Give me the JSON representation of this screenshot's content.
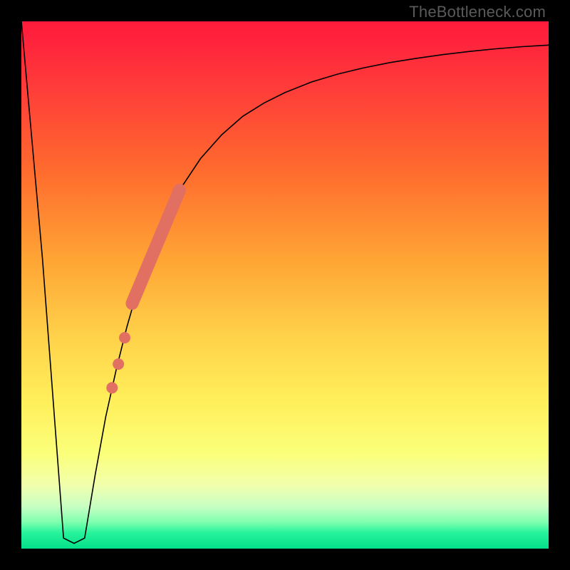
{
  "watermark": "TheBottleneck.com",
  "colors": {
    "gradient_top": "#ff1a3c",
    "gradient_bottom": "#05e08a",
    "curve": "#000000",
    "scatter": "#e27062",
    "frame": "#000000"
  },
  "chart_data": {
    "type": "line",
    "title": "",
    "xlabel": "",
    "ylabel": "",
    "xlim": [
      0,
      100
    ],
    "ylim": [
      0,
      100
    ],
    "series": [
      {
        "name": "bottleneck-curve",
        "x": [
          0,
          4,
          8,
          10,
          12,
          14,
          16,
          18,
          20,
          22,
          24,
          26,
          28,
          30,
          34,
          38,
          42,
          46,
          50,
          55,
          60,
          65,
          70,
          75,
          80,
          85,
          90,
          95,
          100
        ],
        "values": [
          100,
          55,
          2,
          1,
          2,
          14,
          25,
          34,
          42,
          49,
          55,
          60,
          64,
          68,
          74,
          78.5,
          82,
          84.5,
          86.5,
          88.5,
          90,
          91.2,
          92.2,
          93,
          93.7,
          94.3,
          94.8,
          95.2,
          95.5
        ]
      }
    ],
    "scatter_band": {
      "name": "highlight-band",
      "x": [
        21,
        30
      ],
      "values": [
        46.5,
        68
      ]
    },
    "scatter_points": {
      "name": "highlight-dots",
      "x": [
        17.2,
        18.4,
        19.6
      ],
      "values": [
        30.5,
        35,
        40
      ]
    }
  }
}
